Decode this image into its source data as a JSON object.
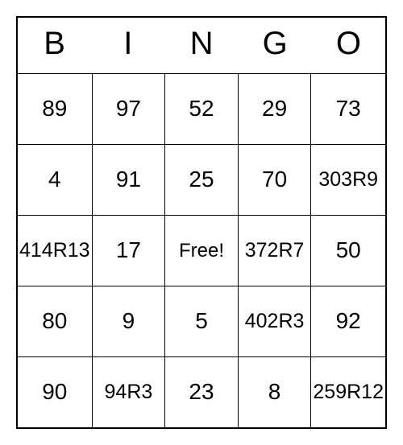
{
  "headers": [
    "B",
    "I",
    "N",
    "G",
    "O"
  ],
  "cells": [
    [
      "89",
      "97",
      "52",
      "29",
      "73"
    ],
    [
      "4",
      "91",
      "25",
      "70",
      "303\nR9"
    ],
    [
      "414\nR13",
      "17",
      "Free!",
      "372\nR7",
      "50"
    ],
    [
      "80",
      "9",
      "5",
      "402\nR3",
      "92"
    ],
    [
      "90",
      "94\nR3",
      "23",
      "8",
      "259\nR12"
    ]
  ],
  "free_label": "Free!"
}
